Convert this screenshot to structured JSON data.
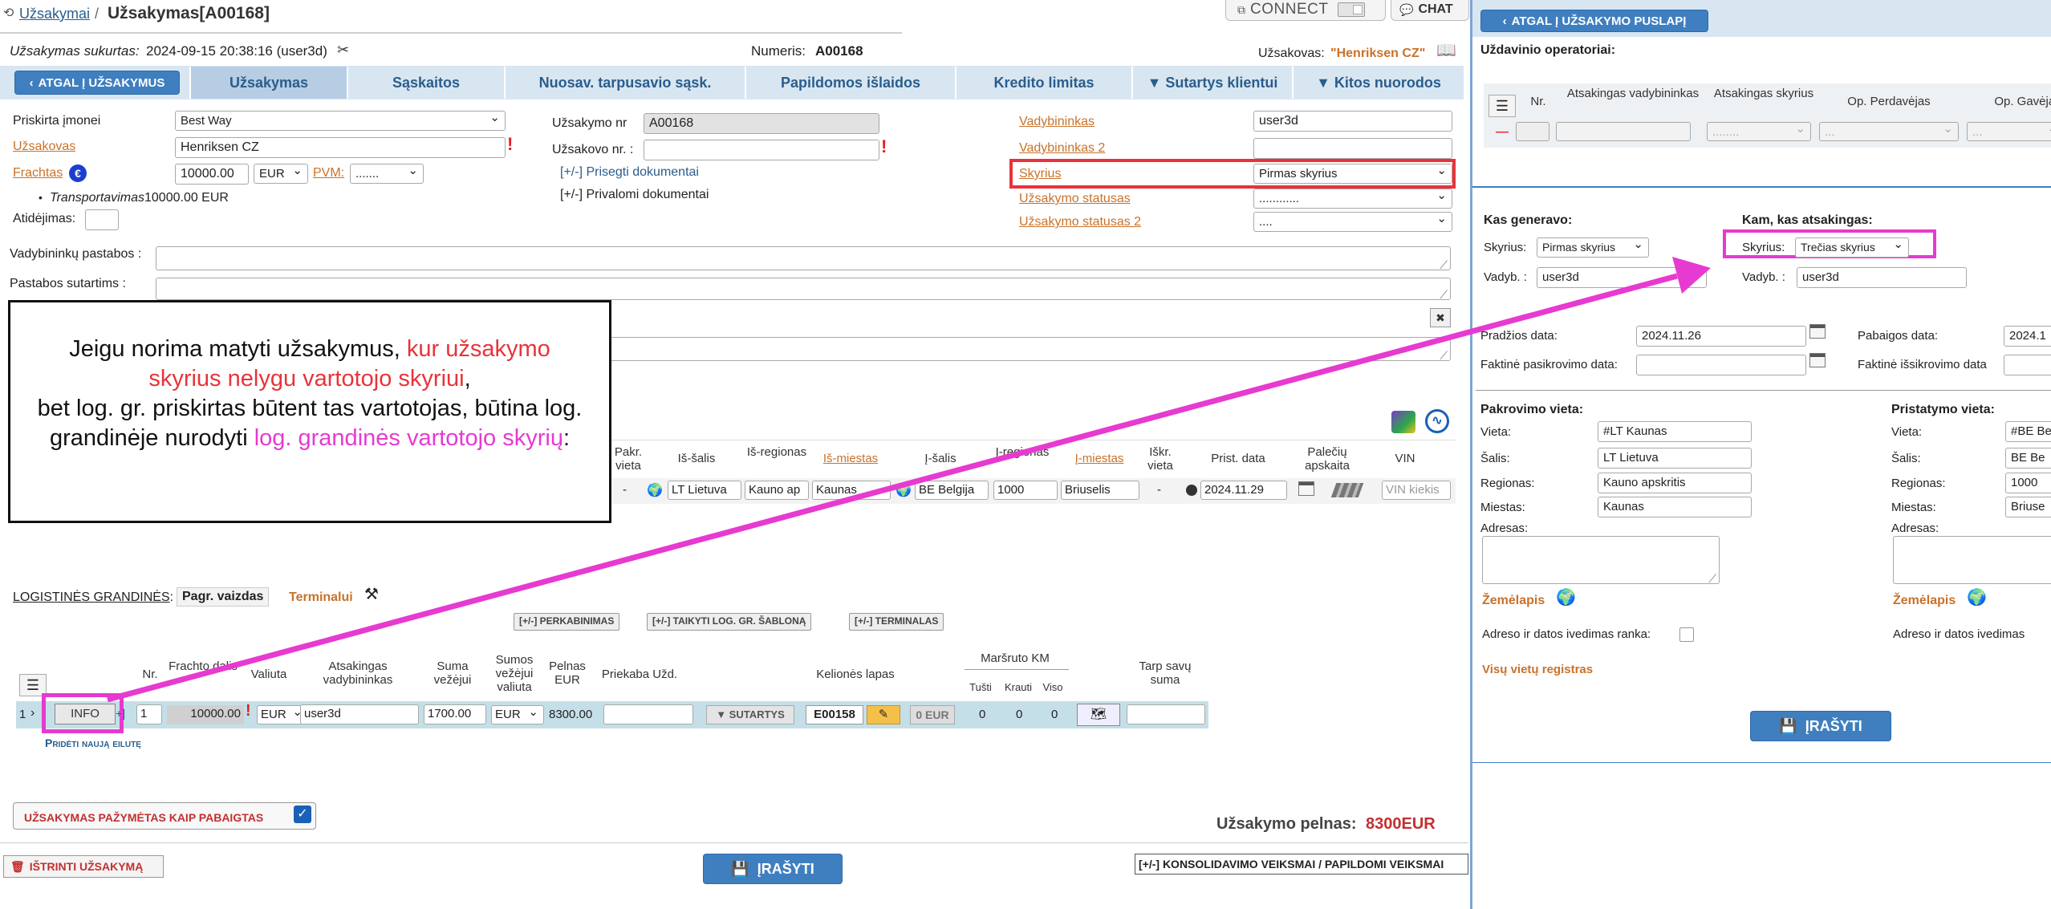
{
  "header": {
    "breadcrumb_root": "Užsakymai",
    "separator": "/",
    "title": "Užsakymas[A00168]",
    "connect_label": "CONNECT",
    "chat_label": "CHAT"
  },
  "meta": {
    "created_label": "Užsakymas sukurtas:",
    "created_value": "2024-09-15 20:38:16 (user3d)",
    "number_label": "Numeris:",
    "number_value": "A00168",
    "customer_label": "Užsakovas:",
    "customer_value": "\"Henriksen CZ\""
  },
  "nav": {
    "back_label": "ATGAL Į UŽSAKYMUS",
    "tabs": [
      "Užsakymas",
      "Sąskaitos",
      "Nuosav. tarpusavio sąsk.",
      "Papildomos išlaidos",
      "Kredito limitas",
      "▼ Sutartys klientui",
      "▼ Kitos nuorodos"
    ]
  },
  "form": {
    "company_label": "Priskirta įmonei",
    "company_value": "Best Way",
    "customer_label": "Užsakovas",
    "customer_value": "Henriksen CZ",
    "freight_label": "Frachtas",
    "freight_value": "10000.00",
    "currency_value": "EUR",
    "vat_label": "PVM:",
    "vat_value": ".......",
    "transport_label": "Transportavimas",
    "transport_value": "10000.00 EUR",
    "delay_label": "Atidėjimas:",
    "order_nr_label": "Užsakymo nr",
    "order_nr_value": "A00168",
    "customer_nr_label": "Užsakovo nr. :",
    "customer_nr_value": "",
    "attach_doc": "[+/-] Prisegti dokumentai",
    "required_doc": "[+/-] Privalomi dokumentai",
    "manager_label": "Vadybininkas",
    "manager_value": "user3d",
    "manager2_label": "Vadybininkas 2",
    "manager2_value": "",
    "department_label": "Skyrius",
    "department_value": "Pirmas skyrius",
    "status_label": "Užsakymo statusas",
    "status_value": "............",
    "status2_label": "Užsakymo statusas 2",
    "status2_value": "....",
    "manager_notes_label": "Vadybininkų pastabos :",
    "contract_notes_label": "Pastabos sutartims :"
  },
  "callout": {
    "part1": "Jeigu norima matyti užsakymus, ",
    "part2": "kur užsakymo skyrius nelygu vartotojo skyriui",
    "part3": ",",
    "part4": "bet log. gr. priskirtas būtent tas vartotojas, būtina log. grandinėje nurodyti ",
    "part5": "log. grandinės vartotojo skyrių",
    "part6": ":"
  },
  "route_table": {
    "headers": [
      "Pakr. vieta",
      "Iš-šalis",
      "Iš-regionas",
      "Iš-miestas",
      "Į-šalis",
      "Į-regionas",
      "Į-miestas",
      "Iškr. vieta",
      "Prist. data",
      "Palečių apskaita",
      "VIN"
    ],
    "row": {
      "pakr": "-",
      "from_country": "LT Lietuva",
      "from_region": "Kauno ap",
      "from_city": "Kaunas",
      "to_country": "BE Belgija",
      "to_region": "1000",
      "to_city": "Briuselis",
      "unload": "-",
      "date": "2024.11.29",
      "vin_placeholder": "VIN kiekis"
    }
  },
  "logistics": {
    "label": "LOGISTINĖS GRANDINĖS",
    "colon": ":",
    "main_view": "Pagr. vaizdas",
    "terminals": "Terminalui",
    "actions": [
      "[+/-] PERKABINIMAS",
      "[+/-] TAIKYTI LOG. GR. ŠABLONĄ",
      "[+/-] TERMINALAS"
    ],
    "headers": [
      "Nr.",
      "Frachto dalis",
      "Valiuta",
      "Atsakingas vadybininkas",
      "Suma vežėjui",
      "Sumos vežėjui valiuta",
      "Pelnas EUR",
      "Priekaba Užd.",
      "Kelionės lapas",
      "Maršruto KM",
      "Tarp savų suma"
    ],
    "km_sub": [
      "Tušti",
      "Krauti",
      "Viso"
    ],
    "row": {
      "index": "1",
      "info": "INFO",
      "plus": "+]",
      "nr": "1",
      "freight": "10000.00",
      "currency": "EUR",
      "manager": "user3d",
      "sum": "1700.00",
      "sum_currency": "EUR",
      "profit": "8300.00",
      "contracts": "▼ SUTARTYS",
      "trip": "E00158",
      "trip_eur": "0 EUR",
      "km_empty": "0",
      "km_loaded": "0",
      "km_total": "0"
    },
    "add_row": "Pridėti naują eilutę"
  },
  "bottom": {
    "finished_label": "UŽSAKYMAS PAŽYMĖTAS KAIP PABAIGTAS",
    "profit_label": "Užsakymo pelnas:",
    "profit_value": "8300EUR",
    "delete_label": "IŠTRINTI UŽSAKYMĄ",
    "save_label": "ĮRAŠYTI",
    "consolidation": "[+/-] KONSOLIDAVIMO VEIKSMAI / PAPILDOMI VEIKSMAI"
  },
  "right": {
    "back_label": "ATGAL Į UŽSAKYMO PUSLAPĮ",
    "operators_label": "Uždavinio operatoriai:",
    "op_headers": [
      "Nr.",
      "Atsakingas vadybininkas",
      "Atsakingas skyrius",
      "Op. Perdavėjas",
      "Op. Gavėjas"
    ],
    "op_row": [
      "",
      "",
      "........",
      "...",
      "..."
    ],
    "gen_title": "Kas generavo:",
    "gen_dept_label": "Skyrius:",
    "gen_dept_value": "Pirmas skyrius",
    "gen_mgr_label": "Vadyb. :",
    "gen_mgr_value": "user3d",
    "resp_title": "Kam, kas atsakingas:",
    "resp_dept_label": "Skyrius:",
    "resp_dept_value": "Trečias skyrius",
    "resp_mgr_label": "Vadyb. :",
    "resp_mgr_value": "user3d",
    "start_label": "Pradžios data:",
    "start_value": "2024.11.26",
    "end_label": "Pabaigos data:",
    "end_value": "2024.1",
    "actual_load_label": "Faktinė pasikrovimo data:",
    "actual_unload_label": "Faktinė išsikrovimo data",
    "load_title": "Pakrovimo vieta:",
    "deliv_title": "Pristatymo vieta:",
    "place_label": "Vieta:",
    "country_label": "Šalis:",
    "region_label": "Regionas:",
    "city_label": "Miestas:",
    "address_label": "Adresas:",
    "load_place": "#LT Kaunas",
    "load_country": "LT Lietuva",
    "load_region": "Kauno apskritis",
    "load_city": "Kaunas",
    "deliv_place": "#BE Be",
    "deliv_country": "BE Be",
    "deliv_region": "1000",
    "deliv_city": "Briuse",
    "map_label": "Žemėlapis",
    "manual_label": "Adreso ir datos ivedimas ranka:",
    "manual_label2": "Adreso ir datos ivedimas",
    "registry_label": "Visų vietų registras",
    "save_label": "ĮRAŠYTI"
  },
  "colors": {
    "accent": "#3f7fc0",
    "highlight_red": "#e8333a",
    "highlight_magenta": "#e63ad0",
    "orange_label": "#c8722a"
  }
}
